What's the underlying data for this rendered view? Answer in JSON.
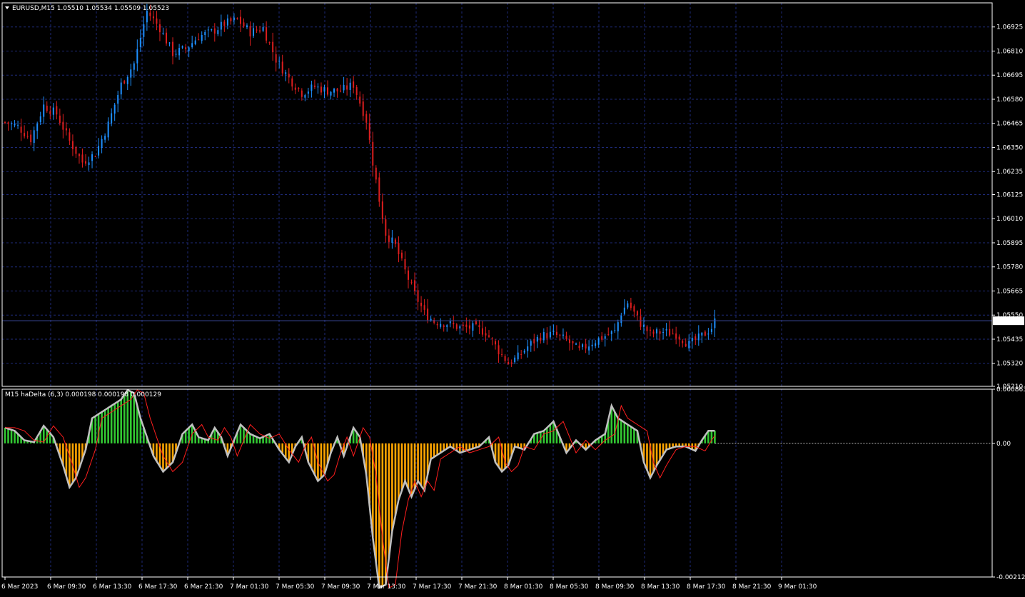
{
  "window": {
    "symbol_header": "EURUSD,M15  1.05510 1.05534 1.05509 1.05523",
    "indicator_header": "M15 haDelta (6,3) 0.000198 0.000198 0.000129"
  },
  "colors": {
    "background": "#000000",
    "grid": "#1e2a78",
    "up_candle": "#1e90ff",
    "down_candle": "#dc1e1e",
    "hist_positive": "#32c832",
    "hist_negative": "#ffa500",
    "signal_line": "#ff1e1e",
    "delta_line": "#c0c0c0",
    "price_line": "#3a4a9a"
  },
  "chart_data": [
    {
      "type": "candlestick",
      "title": "EURUSD,M15",
      "ylim": [
        1.0521,
        1.0704
      ],
      "y_ticks": [
        "1.06925",
        "1.06810",
        "1.06695",
        "1.06580",
        "1.06465",
        "1.06350",
        "1.06235",
        "1.06125",
        "1.06010",
        "1.05895",
        "1.05780",
        "1.05665",
        "1.05550",
        "1.05435",
        "1.05320",
        "1.05210"
      ],
      "current_price": 1.05523,
      "current_price_label": "1.05523",
      "x_ticks": [
        "6 Mar 2023",
        "6 Mar 09:30",
        "6 Mar 13:30",
        "6 Mar 17:30",
        "6 Mar 21:30",
        "7 Mar 01:30",
        "7 Mar 05:30",
        "7 Mar 09:30",
        "7 Mar 13:30",
        "7 Mar 17:30",
        "7 Mar 21:30",
        "8 Mar 01:30",
        "8 Mar 05:30",
        "8 Mar 09:30",
        "8 Mar 13:30",
        "8 Mar 17:30",
        "8 Mar 21:30",
        "9 Mar 01:30"
      ],
      "close_path": [
        [
          0,
          1.0647
        ],
        [
          4,
          1.0645
        ],
        [
          8,
          1.0639
        ],
        [
          12,
          1.0655
        ],
        [
          16,
          1.0651
        ],
        [
          20,
          1.0638
        ],
        [
          24,
          1.0628
        ],
        [
          28,
          1.0632
        ],
        [
          32,
          1.0646
        ],
        [
          36,
          1.0665
        ],
        [
          40,
          1.0675
        ],
        [
          44,
          1.07
        ],
        [
          48,
          1.0692
        ],
        [
          52,
          1.068
        ],
        [
          56,
          1.0682
        ],
        [
          60,
          1.0688
        ],
        [
          64,
          1.069
        ],
        [
          68,
          1.0694
        ],
        [
          72,
          1.0696
        ],
        [
          76,
          1.069
        ],
        [
          80,
          1.0692
        ],
        [
          84,
          1.0677
        ],
        [
          88,
          1.0668
        ],
        [
          92,
          1.0661
        ],
        [
          96,
          1.0664
        ],
        [
          100,
          1.0662
        ],
        [
          104,
          1.0662
        ],
        [
          108,
          1.0665
        ],
        [
          112,
          1.0648
        ],
        [
          114,
          1.0628
        ],
        [
          116,
          1.061
        ],
        [
          118,
          1.0594
        ],
        [
          121,
          1.0588
        ],
        [
          124,
          1.0576
        ],
        [
          127,
          1.0565
        ],
        [
          130,
          1.0556
        ],
        [
          133,
          1.0552
        ],
        [
          137,
          1.0551
        ],
        [
          141,
          1.0549
        ],
        [
          145,
          1.0549
        ],
        [
          149,
          1.0547
        ],
        [
          153,
          1.0538
        ],
        [
          156,
          1.0532
        ],
        [
          159,
          1.0535
        ],
        [
          162,
          1.054
        ],
        [
          166,
          1.0545
        ],
        [
          170,
          1.0546
        ],
        [
          174,
          1.0543
        ],
        [
          178,
          1.0538
        ],
        [
          182,
          1.0542
        ],
        [
          186,
          1.0545
        ],
        [
          189,
          1.0547
        ],
        [
          191,
          1.0556
        ],
        [
          193,
          1.0561
        ],
        [
          195,
          1.0556
        ],
        [
          197,
          1.0551
        ],
        [
          200,
          1.0546
        ],
        [
          204,
          1.0547
        ],
        [
          208,
          1.0546
        ],
        [
          212,
          1.0541
        ],
        [
          216,
          1.0545
        ],
        [
          219,
          1.0549
        ],
        [
          220,
          1.0552
        ]
      ],
      "n_bars": 221
    },
    {
      "type": "bar",
      "title": "M15 haDelta (6,3)",
      "ylim": [
        -0.002128,
        0.000863
      ],
      "y_ticks": [
        "0.000863",
        "0.00",
        "-0.002128"
      ],
      "values_readout": [
        0.000198,
        0.000198,
        0.000129
      ],
      "delta_path": [
        [
          0,
          0.00025
        ],
        [
          3,
          0.0002
        ],
        [
          6,
          5e-05
        ],
        [
          9,
          2e-05
        ],
        [
          12,
          0.00028
        ],
        [
          15,
          0.0001
        ],
        [
          18,
          -0.00035
        ],
        [
          20,
          -0.0007
        ],
        [
          22,
          -0.00055
        ],
        [
          25,
          -0.0001
        ],
        [
          27,
          0.0004
        ],
        [
          30,
          0.0005
        ],
        [
          33,
          0.0006
        ],
        [
          36,
          0.0007
        ],
        [
          38,
          0.00085
        ],
        [
          40,
          0.0008
        ],
        [
          42,
          0.0004
        ],
        [
          44,
          0.0001
        ],
        [
          46,
          -0.0002
        ],
        [
          49,
          -0.00045
        ],
        [
          52,
          -0.0003
        ],
        [
          55,
          0.00015
        ],
        [
          58,
          0.0003
        ],
        [
          60,
          0.0001
        ],
        [
          63,
          5e-05
        ],
        [
          65,
          0.00025
        ],
        [
          67,
          0.0001
        ],
        [
          69,
          -0.0002
        ],
        [
          71,
          5e-05
        ],
        [
          73,
          0.0003
        ],
        [
          76,
          0.00015
        ],
        [
          79,
          8e-05
        ],
        [
          82,
          0.00015
        ],
        [
          85,
          -0.0001
        ],
        [
          88,
          -0.0003
        ],
        [
          90,
          -5e-05
        ],
        [
          92,
          0.0001
        ],
        [
          94,
          -0.0003
        ],
        [
          97,
          -0.0006
        ],
        [
          99,
          -0.0005
        ],
        [
          101,
          -0.00015
        ],
        [
          103,
          0.0001
        ],
        [
          105,
          -0.0002
        ],
        [
          108,
          0.00025
        ],
        [
          110,
          0.0001
        ],
        [
          112,
          -0.0005
        ],
        [
          114,
          -0.0015
        ],
        [
          116,
          -0.0023
        ],
        [
          118,
          -0.00225
        ],
        [
          120,
          -0.0014
        ],
        [
          122,
          -0.0009
        ],
        [
          124,
          -0.0006
        ],
        [
          126,
          -0.00085
        ],
        [
          128,
          -0.0006
        ],
        [
          130,
          -0.00075
        ],
        [
          132,
          -0.00025
        ],
        [
          135,
          -0.00015
        ],
        [
          138,
          -5e-05
        ],
        [
          141,
          -0.00015
        ],
        [
          144,
          -0.0001
        ],
        [
          147,
          -5e-05
        ],
        [
          150,
          0.0001
        ],
        [
          152,
          -0.0003
        ],
        [
          154,
          -0.00045
        ],
        [
          156,
          -0.00035
        ],
        [
          158,
          -5e-05
        ],
        [
          161,
          -0.0001
        ],
        [
          164,
          0.00015
        ],
        [
          167,
          0.0002
        ],
        [
          170,
          0.00035
        ],
        [
          172,
          0.0001
        ],
        [
          174,
          -0.00015
        ],
        [
          177,
          5e-05
        ],
        [
          180,
          -0.0001
        ],
        [
          183,
          5e-05
        ],
        [
          186,
          0.00015
        ],
        [
          188,
          0.0006
        ],
        [
          190,
          0.0004
        ],
        [
          193,
          0.0003
        ],
        [
          196,
          0.0002
        ],
        [
          198,
          -0.0003
        ],
        [
          200,
          -0.00055
        ],
        [
          202,
          -0.00035
        ],
        [
          205,
          -0.0001
        ],
        [
          208,
          -5e-05
        ],
        [
          211,
          -5e-05
        ],
        [
          214,
          -0.00012
        ],
        [
          216,
          5e-05
        ],
        [
          218,
          0.0002
        ],
        [
          220,
          0.0002
        ]
      ],
      "n_bars": 221
    }
  ]
}
